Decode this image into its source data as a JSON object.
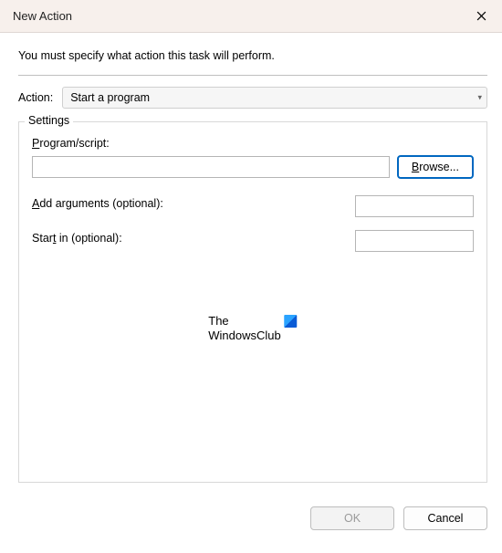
{
  "titlebar": {
    "title": "New Action"
  },
  "intro": "You must specify what action this task will perform.",
  "action": {
    "label": "Action:",
    "selected": "Start a program"
  },
  "settings": {
    "legend": "Settings",
    "program_label_pre": "P",
    "program_label_rest": "rogram/script:",
    "program_value": "",
    "browse_label_pre": "B",
    "browse_label_rest": "rowse...",
    "args_label_pre": "A",
    "args_label_rest": "dd arguments (optional):",
    "args_value": "",
    "startin_label_pre_s": "S",
    "startin_label_mid": "tar",
    "startin_label_under": "t",
    "startin_label_rest": " in (optional):",
    "startin_value": ""
  },
  "watermark": {
    "line1": "The",
    "line2": "WindowsClub"
  },
  "footer": {
    "ok": "OK",
    "cancel": "Cancel"
  }
}
